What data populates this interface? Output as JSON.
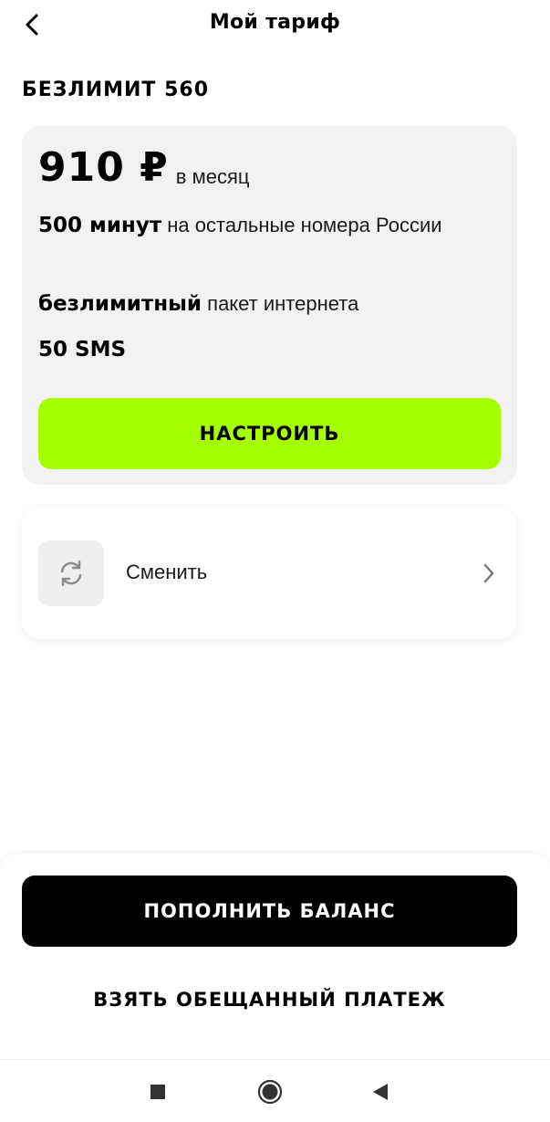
{
  "header": {
    "title": "Мой тариф",
    "back_icon": "chevron-left-icon"
  },
  "tariff": {
    "name": "БЕЗЛИМИТ 560",
    "price": "910 ₽",
    "price_unit": "в месяц",
    "features": [
      {
        "bold": "500 минут",
        "text": " на остальные номера России"
      },
      {
        "bold": "безлимитный",
        "text": " пакет интернета"
      },
      {
        "bold": "50 SMS",
        "text": ""
      }
    ],
    "configure_label": "НАСТРОИТЬ",
    "accent_color": "#a6ff00"
  },
  "change": {
    "label": "Сменить",
    "icon": "refresh-icon",
    "chevron": "chevron-right-icon"
  },
  "bottom": {
    "topup_label": "ПОПОЛНИТЬ БАЛАНС",
    "promise_label": "ВЗЯТЬ ОБЕЩАННЫЙ ПЛАТЕЖ"
  },
  "nav": {
    "icons": [
      "square-icon",
      "home-circle-icon",
      "back-triangle-icon"
    ]
  }
}
